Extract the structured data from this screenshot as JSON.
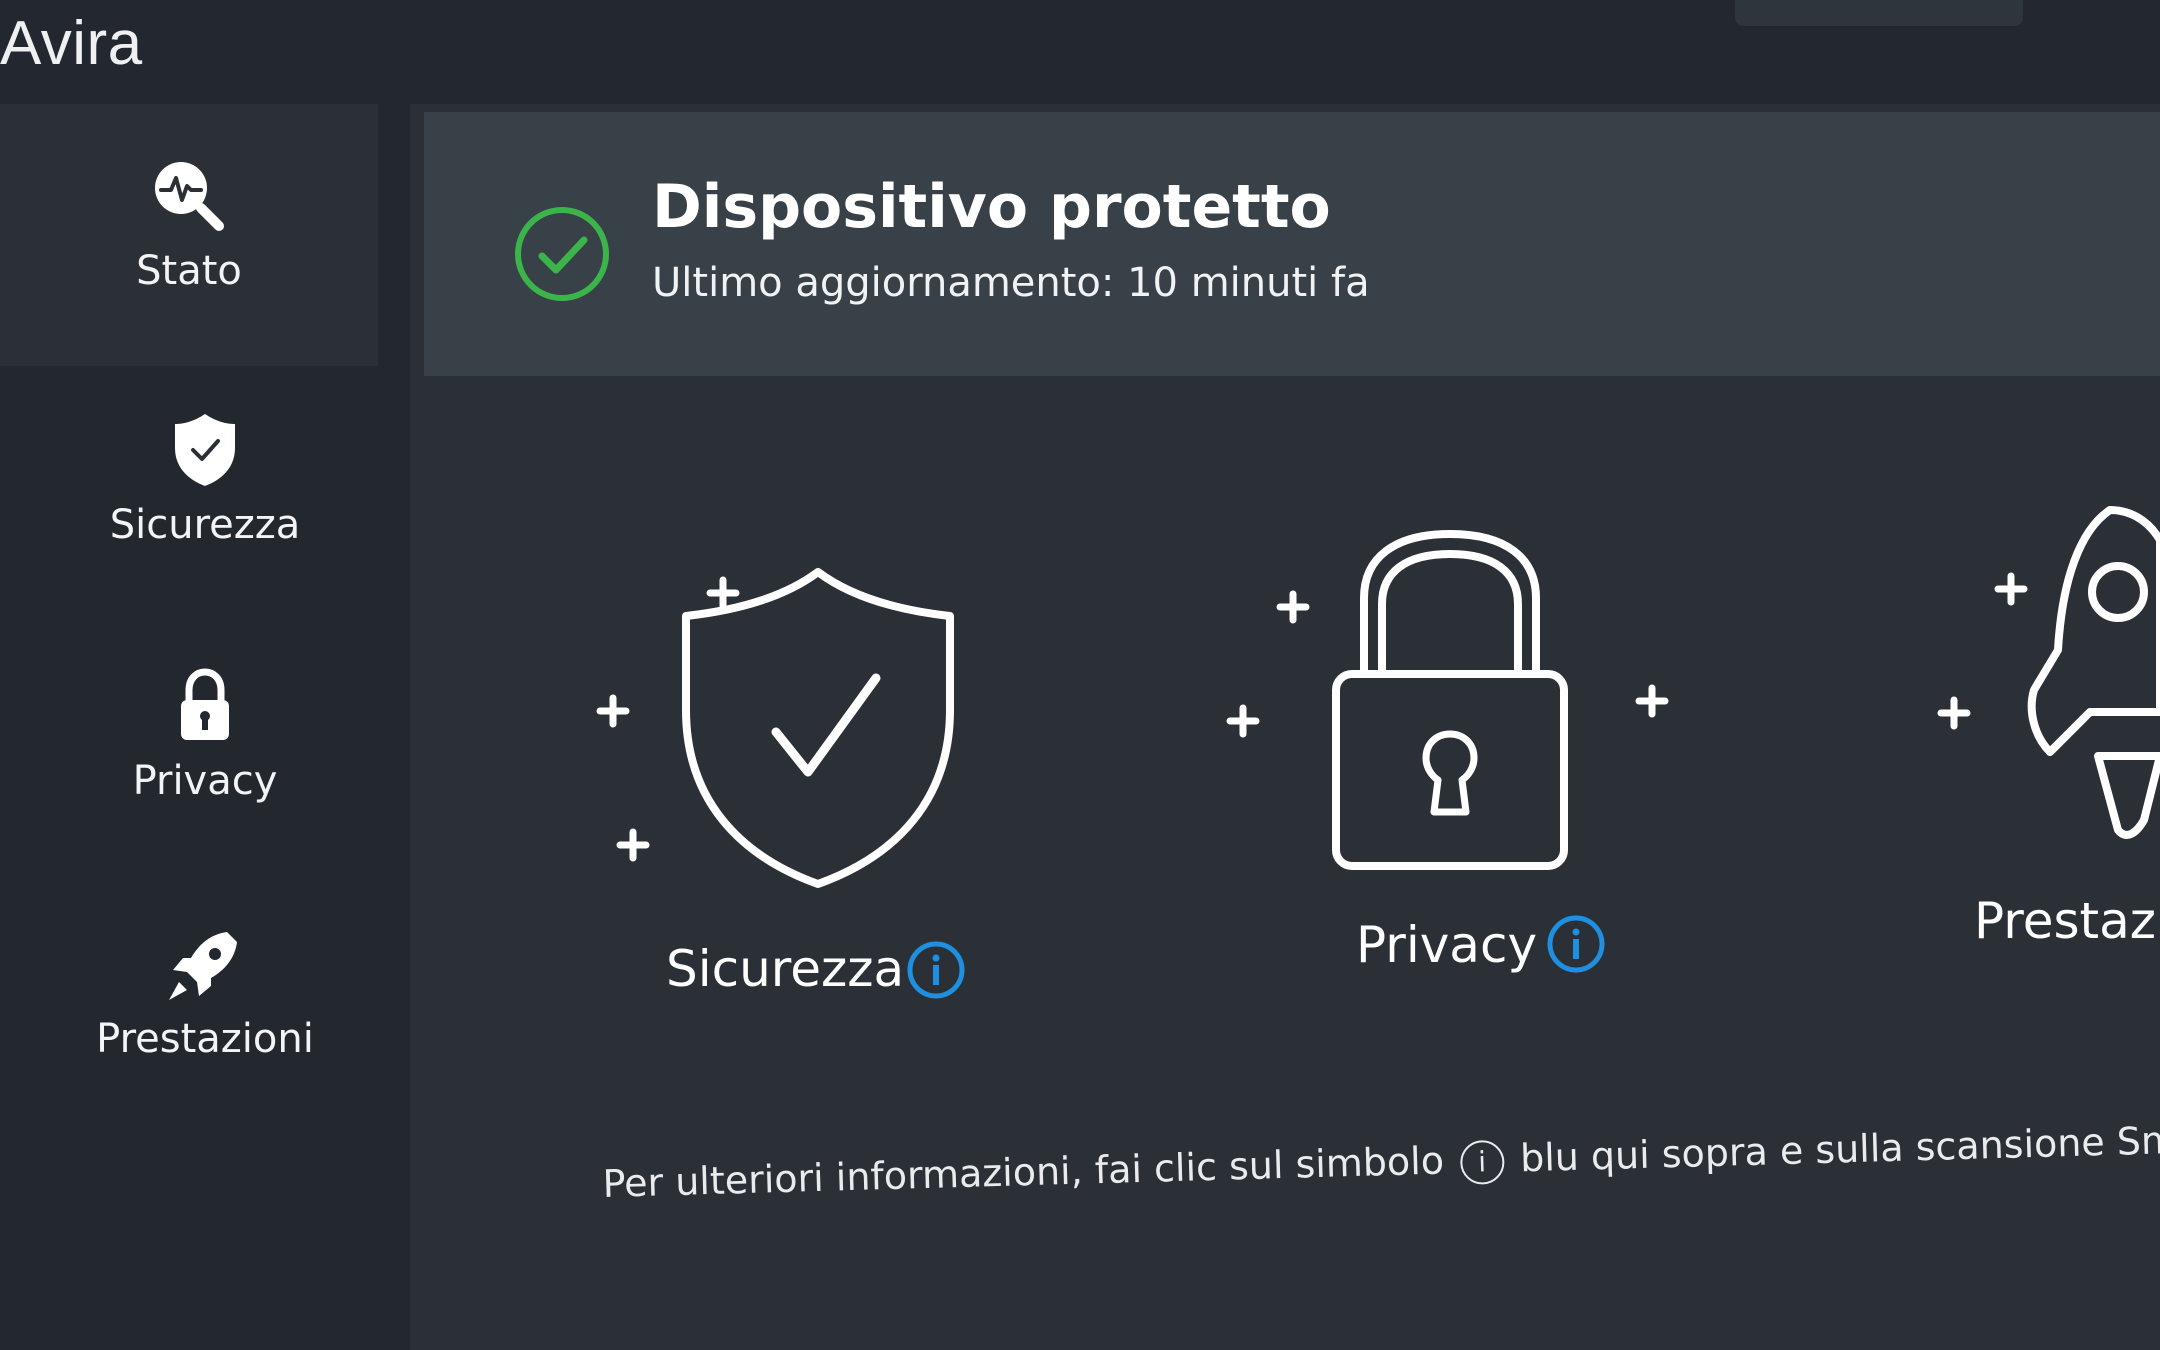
{
  "app": {
    "title": "Avira"
  },
  "sidebar": {
    "items": [
      {
        "label": "Stato",
        "icon": "status-magnifier-icon"
      },
      {
        "label": "Sicurezza",
        "icon": "shield-check-icon"
      },
      {
        "label": "Privacy",
        "icon": "padlock-icon"
      },
      {
        "label": "Prestazioni",
        "icon": "rocket-icon"
      }
    ]
  },
  "status": {
    "title": "Dispositivo protetto",
    "subtitle": "Ultimo aggiornamento: 10 minuti fa",
    "icon": "check-circle-icon",
    "color": "#3bb54a"
  },
  "features": [
    {
      "label": "Sicurezza",
      "icon": "shield-check-icon"
    },
    {
      "label": "Privacy",
      "icon": "padlock-icon"
    },
    {
      "label": "Prestazi",
      "icon": "rocket-icon"
    }
  ],
  "footer": {
    "text_before": "Per ulteriori informazioni, fai clic sul simbolo",
    "info_symbol": "i",
    "text_after": "blu qui sopra e sulla scansione Sma"
  },
  "colors": {
    "accent": "#1e8fe1",
    "ok": "#3bb54a",
    "background": "#2b3037",
    "sidebar": "#23282f",
    "banner": "#384148"
  }
}
